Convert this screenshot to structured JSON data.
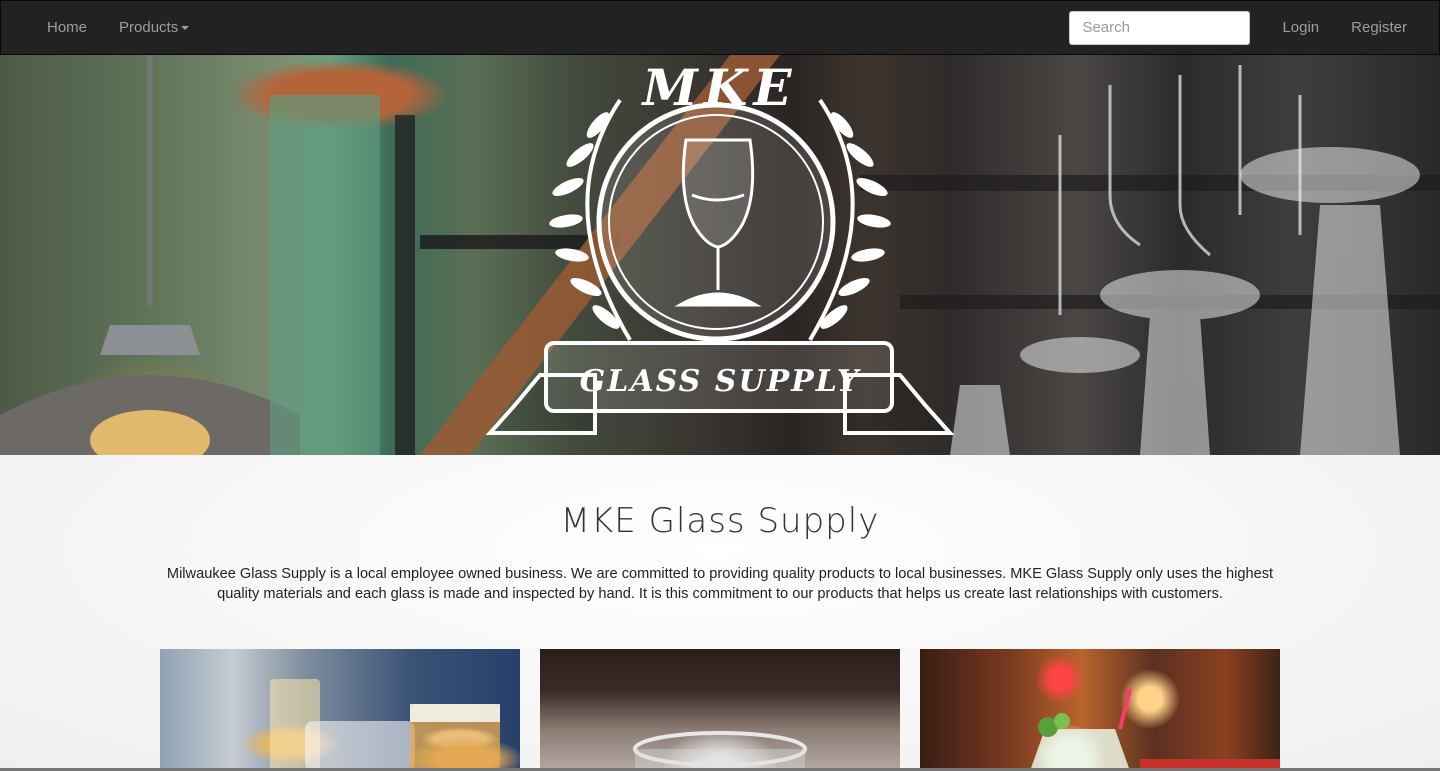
{
  "navbar": {
    "home_label": "Home",
    "products_label": "Products",
    "search_placeholder": "Search",
    "login_label": "Login",
    "register_label": "Register"
  },
  "hero": {
    "logo_top_text": "MKE",
    "logo_banner_text": "GLASS SUPPLY",
    "icons": [
      "wheat-laurel-icon",
      "tulip-glass-icon",
      "ribbon-banner-icon"
    ]
  },
  "main": {
    "title": "MKE Glass Supply",
    "intro": "Milwaukee Glass Supply is a local employee owned business. We are committed to providing quality products to local businesses. MKE Glass Supply only uses the highest quality materials and each glass is made and inspected by hand. It is this commitment to our products that helps us create last relationships with customers."
  },
  "colors": {
    "navbar_bg": "#222222",
    "nav_text": "#9d9d9d",
    "page_bg": "#f3f3f3"
  }
}
